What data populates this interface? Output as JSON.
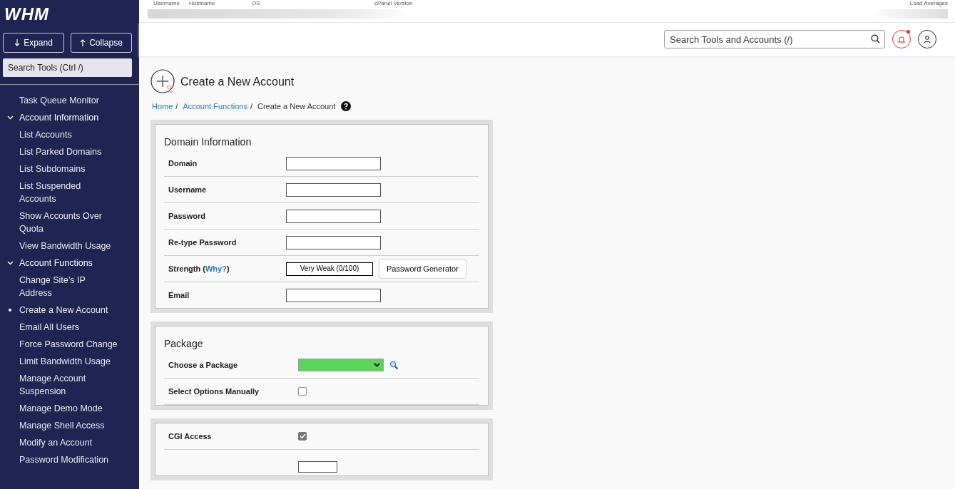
{
  "sidebar": {
    "logo": "WHM",
    "buttons": [
      {
        "label": "Expand",
        "kind": "down"
      },
      {
        "label": "Collapse",
        "kind": "up"
      }
    ],
    "search": {
      "placeholder": "Search Tools (Ctrl /)"
    },
    "items": [
      {
        "label": "Task Queue Monitor",
        "selected": false
      },
      {
        "label": "Account Information",
        "expanded": true,
        "children": [
          {
            "label": "List Accounts",
            "selected": false
          },
          {
            "label": "List Parked Domains",
            "selected": false
          },
          {
            "label": "List Subdomains",
            "selected": false
          },
          {
            "label": "List Suspended Accounts",
            "selected": false
          },
          {
            "label": "Show Accounts Over Quota",
            "selected": false
          },
          {
            "label": "View Bandwidth Usage",
            "selected": false
          }
        ]
      },
      {
        "label": "Account Functions",
        "expanded": true,
        "children": [
          {
            "label": "Change Site’s IP Address",
            "selected": false
          },
          {
            "label": "Create a New Account",
            "selected": true
          },
          {
            "label": "Email All Users",
            "selected": false
          },
          {
            "label": "Force Password Change",
            "selected": false
          },
          {
            "label": "Limit Bandwidth Usage",
            "selected": false
          },
          {
            "label": "Manage Account Suspension",
            "selected": false
          },
          {
            "label": "Manage Demo Mode",
            "selected": false
          },
          {
            "label": "Manage Shell Access",
            "selected": false
          },
          {
            "label": "Modify an Account",
            "selected": false
          },
          {
            "label": "Password Modification",
            "selected": false
          }
        ]
      }
    ]
  },
  "server_info": {
    "columns": [
      "Username",
      "Hostname",
      "OS",
      "cPanel Version",
      "Load Averages"
    ]
  },
  "header": {
    "search": {
      "placeholder": "Search Tools and Accounts (/)"
    },
    "notifications_unread": true
  },
  "page": {
    "title": "Create a New Account",
    "breadcrumb": [
      {
        "label": "Home",
        "link": true,
        "separator": "/"
      },
      {
        "label": "Account Functions",
        "link": true,
        "separator": "/"
      },
      {
        "label": "Create a New Account",
        "link": false
      }
    ]
  },
  "sections": [
    {
      "title": "Domain Information",
      "rows": [
        {
          "kind": "text",
          "label": "Domain"
        },
        {
          "kind": "text",
          "label": "Username"
        },
        {
          "kind": "text",
          "label": "Password"
        },
        {
          "kind": "text",
          "label": "Re-type Password"
        },
        {
          "kind": "strength",
          "label": "Strength (",
          "link": "Why?",
          "suffix": ")",
          "meter": "Very Weak (0/100)",
          "button": "Password Generator"
        },
        {
          "kind": "text",
          "label": "Email"
        }
      ]
    },
    {
      "title": "Package",
      "rows": [
        {
          "kind": "select",
          "label": "Choose a Package"
        },
        {
          "kind": "checkbox",
          "label": "Select Options Manually",
          "checked": false
        }
      ]
    },
    {
      "rows": [
        {
          "kind": "checkbox",
          "label": "CGI Access",
          "checked": true
        }
      ]
    }
  ]
}
